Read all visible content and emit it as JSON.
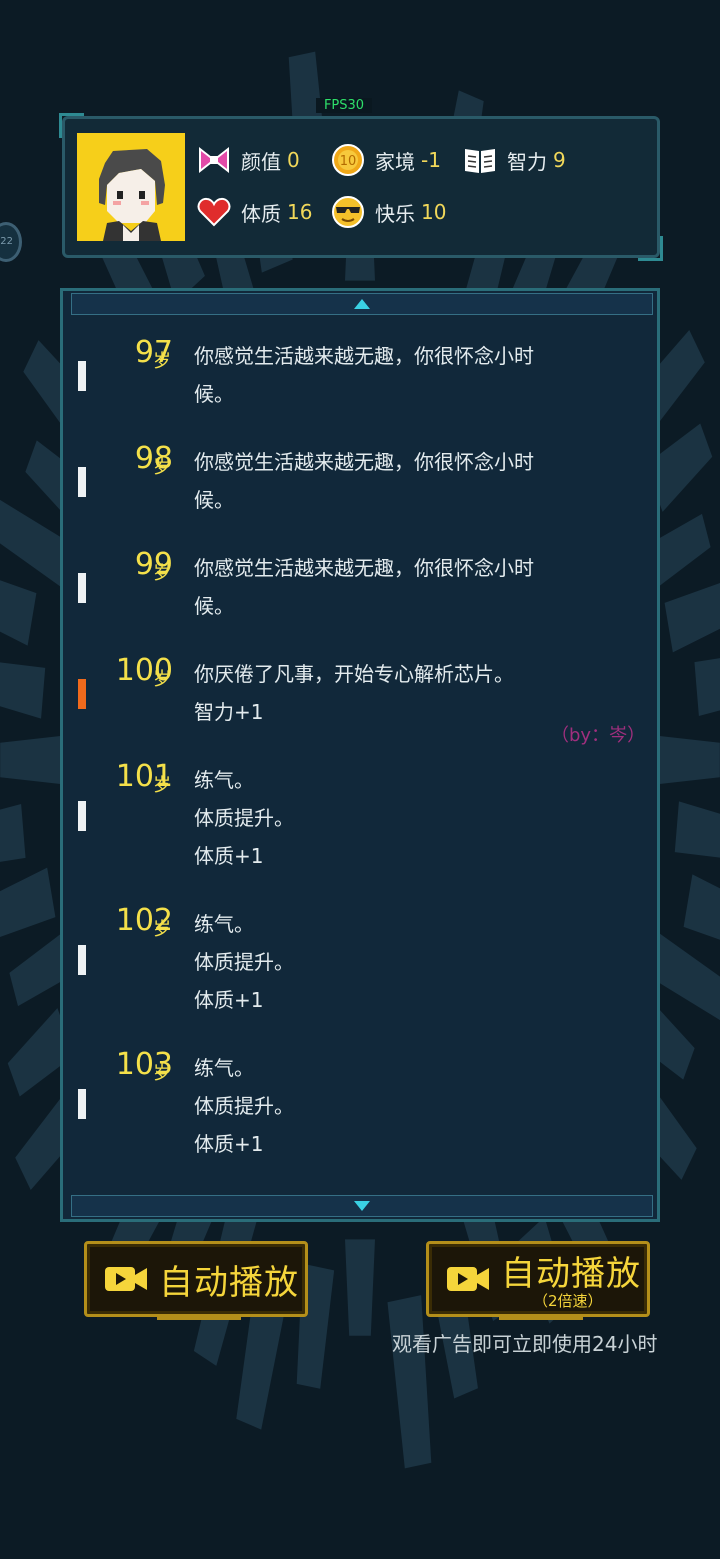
{
  "fps": "FPS30",
  "side_bubble": "22",
  "stats": [
    {
      "icon": "bow-icon",
      "label": "颜值",
      "value": "0"
    },
    {
      "icon": "coin-icon",
      "label": "家境",
      "value": "-1"
    },
    {
      "icon": "book-icon",
      "label": "智力",
      "value": "9"
    },
    {
      "icon": "heart-icon",
      "label": "体质",
      "value": "16"
    },
    {
      "icon": "sunglasses-icon",
      "label": "快乐",
      "value": "10"
    }
  ],
  "age_unit": "岁",
  "log": [
    {
      "age": "97",
      "marker": "white",
      "lines": [
        "你感觉生活越来越无趣，你很怀念小时",
        "候。"
      ]
    },
    {
      "age": "98",
      "marker": "white",
      "lines": [
        "你感觉生活越来越无趣，你很怀念小时",
        "候。"
      ]
    },
    {
      "age": "99",
      "marker": "white",
      "lines": [
        "你感觉生活越来越无趣，你很怀念小时",
        "候。"
      ]
    },
    {
      "age": "100",
      "marker": "orange",
      "lines": [
        "你厌倦了凡事，开始专心解析芯片。",
        "智力+1"
      ]
    },
    {
      "age": "101",
      "marker": "white",
      "lines": [
        "练气。",
        "体质提升。",
        "体质+1"
      ]
    },
    {
      "age": "102",
      "marker": "white",
      "lines": [
        "练气。",
        "体质提升。",
        "体质+1"
      ]
    },
    {
      "age": "103",
      "marker": "white",
      "lines": [
        "练气。",
        "体质提升。",
        "体质+1"
      ]
    }
  ],
  "byline": "（by：岑）",
  "buttons": {
    "auto_play": "自动播放",
    "auto_play_2x": "自动播放",
    "auto_play_2x_sub": "（2倍速）"
  },
  "ad_note": "观看广告即可立即使用24小时",
  "colors": {
    "accent": "#f4e04a",
    "panel": "#11283a",
    "border": "#2a6d79",
    "orange_marker": "#f06a1c"
  }
}
